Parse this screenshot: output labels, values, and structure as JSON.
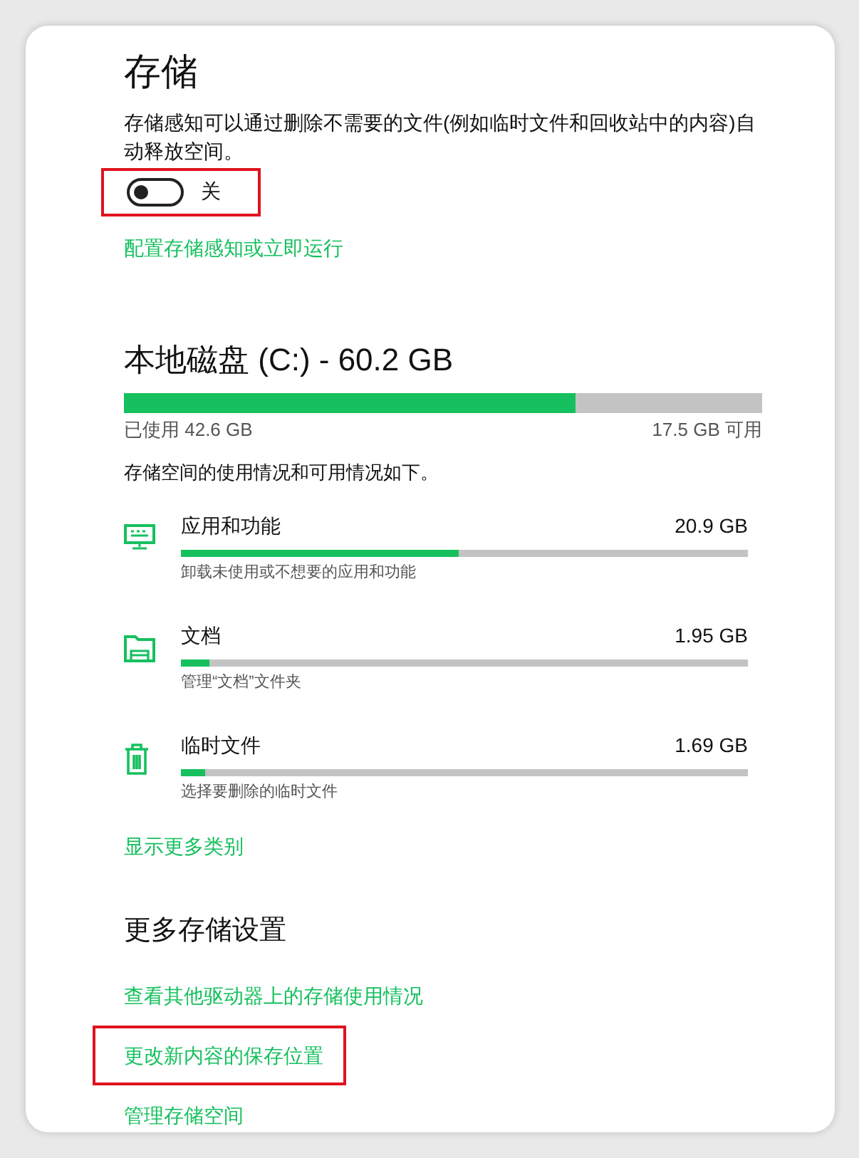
{
  "storage": {
    "title": "存储",
    "description": "存储感知可以通过删除不需要的文件(例如临时文件和回收站中的内容)自动释放空间。",
    "toggle": {
      "on": false,
      "label": "关",
      "highlighted": true
    },
    "link": "配置存储感知或立即运行"
  },
  "disk": {
    "title": "本地磁盘 (C:) - 60.2 GB",
    "level": 0.708,
    "used": "已使用 42.6 GB",
    "free": "17.5 GB 可用",
    "description": "存储空间的使用情况和可用情况如下。",
    "categories": [
      {
        "kind": "apps",
        "name": "应用和功能",
        "size": "20.9 GB",
        "level": 0.49,
        "hint": "卸载未使用或不想要的应用和功能"
      },
      {
        "kind": "documents",
        "name": "文档",
        "size": "1.95 GB",
        "level": 0.05,
        "hint": "管理“文档”文件夹"
      },
      {
        "kind": "temp",
        "name": "临时文件",
        "size": "1.69 GB",
        "level": 0.043,
        "hint": "选择要删除的临时文件"
      }
    ],
    "more_link": "显示更多类别"
  },
  "more_settings": {
    "title": "更多存储设置",
    "links": [
      {
        "label": "查看其他驱动器上的存储使用情况",
        "highlighted": false
      },
      {
        "label": "更改新内容的保存位置",
        "highlighted": true
      },
      {
        "label": "管理存储空间",
        "highlighted": false
      }
    ]
  }
}
